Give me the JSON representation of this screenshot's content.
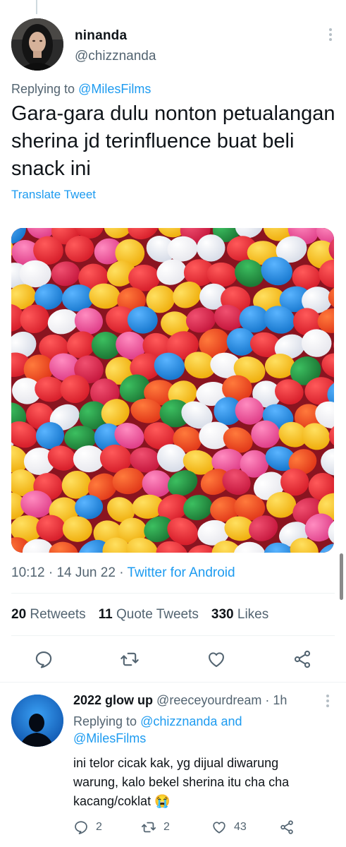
{
  "tweet": {
    "author_name": "ninanda",
    "author_handle": "@chizznanda",
    "replying_prefix": "Replying to",
    "replying_to": "@MilesFilms",
    "text": "Gara-gara dulu nonton petualangan sherina jd terinfluence buat beli snack ini",
    "translate_label": "Translate Tweet",
    "time": "10:12",
    "sep1": "·",
    "date": "14 Jun 22",
    "sep2": "·",
    "source": "Twitter for Android",
    "retweets_count": "20",
    "retweets_label": "Retweets",
    "quotes_count": "11",
    "quotes_label": "Quote Tweets",
    "likes_count": "330",
    "likes_label": "Likes",
    "actions": [
      "reply-icon",
      "retweet-icon",
      "like-icon",
      "share-icon"
    ]
  },
  "reply": {
    "author_name": "2022 glow up",
    "author_handle": "@reeceyourdream",
    "sep": "·",
    "age": "1h",
    "replying_prefix": "Replying to",
    "replying_to_1": "@chizznanda",
    "and_word": "and",
    "replying_to_2": "@MilesFilms",
    "text": "ini telor cicak kak, yg dijual diwarung warung, kalo bekel sherina itu cha cha kacang/coklat 😭",
    "reply_count": "2",
    "retweet_count": "2",
    "like_count": "43"
  },
  "colors": {
    "link": "#1d9bf0",
    "secondary_text": "#536471",
    "primary_text": "#0f1419",
    "divider": "#eff3f4"
  }
}
